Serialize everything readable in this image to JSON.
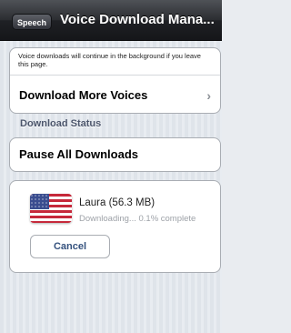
{
  "navbar": {
    "back_label": "Speech",
    "title": "Voice Download Mana..."
  },
  "downloads_group": {
    "notice": "Voice downloads will continue in the background if you leave this page.",
    "more_voices_label": "Download More Voices"
  },
  "status_section": {
    "header": "Download Status",
    "pause_all_label": "Pause All Downloads"
  },
  "voice_item": {
    "flag_icon": "us-flag-icon",
    "name": "Laura (56.3 MB)",
    "status": "Downloading... 0.1% complete",
    "cancel_label": "Cancel"
  }
}
